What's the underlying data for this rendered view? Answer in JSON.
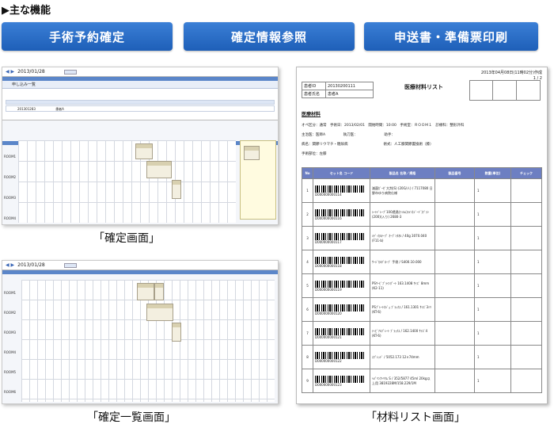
{
  "heading": "▶主な機能",
  "buttons": [
    "手術予約確定",
    "確定情報参照",
    "申送書・準備票印刷"
  ],
  "captions": [
    "「確定画面」",
    "「確定一覧画面」",
    "「材料リスト画面」"
  ],
  "shot1": {
    "date": "2013/01/28",
    "list_title": "申し込み一覧",
    "list_row_id": "201301283",
    "list_row_name": "患者A",
    "rooms": [
      "ROOM1",
      "ROOM2",
      "ROOM3",
      "ROOM4"
    ],
    "card_name": "患者A"
  },
  "shot2": {
    "date": "2013/01/28",
    "rooms": [
      "ROOM1",
      "ROOM2",
      "ROOM3",
      "ROOM4",
      "ROOM5",
      "ROOM6"
    ],
    "card_name": "患者A"
  },
  "doc": {
    "print_date": "2013年04月08日(11時02分)作成",
    "page": "1 / 2",
    "title": "医療材料リスト",
    "label_id": "患者ID",
    "patient_id": "20130200111",
    "label_name": "患者氏名",
    "patient_name": "患者A",
    "section": "医療材料",
    "line1": "オペ区分：通常　手術日：2013/02/01　開始時間：10:00　手術室：ＲＯＯＭ１　診療科：整形外科",
    "line2": "主治医：医師A　　　　　執刀医：　　　　　　　　助手：",
    "line3": "病名：関節リウマチ・糖尿病　　　　　　　　　　術式：人工膝関節置換術（膝）",
    "line4": "手術部位：左膝",
    "headers": [
      "No",
      "セット名 コード",
      "製品名 名称／規格",
      "製品番号",
      "数量(単位)",
      "チェック"
    ],
    "rows": [
      {
        "no": "1",
        "code": "D000000000114",
        "name": "滅菌ｶﾞｰｾﾞ大判(S) (20G/人) / 7117080 日野市ゆり病院仕様",
        "qty": "1"
      },
      {
        "no": "2",
        "code": "D000000000116",
        "name": "ｼｰﾄﾄﾞﾚｰﾌﾟ100透過(ﾌｨﾙﾑ)ﾗｲﾝ(ｼﾞｰﾄﾞ)ﾌﾞﾗﾝ(200)(入り) 2680-3",
        "qty": "1"
      },
      {
        "no": "3",
        "code": "D000000000117",
        "name": "ﾒﾃﾞｨｶﾙﾃｰﾌﾟ ｵｰﾌﾟﾝﾀｵﾙ / 40g 3070.040 (F11-b)",
        "qty": "1"
      },
      {
        "no": "4",
        "code": "D000000000118",
        "name": "ｻｰｼﾞｶﾙｸﾞﾛｰﾌﾞ 手袋 / S400.10.000",
        "qty": "1"
      },
      {
        "no": "5",
        "code": "D000000000119",
        "name": "PSｻｰﾋﾞﾌﾟﾗｲﾝﾎﾟｰﾄ 163.1408 ｻｲｽﾞ 8mm (K2-11)",
        "qty": "1"
      },
      {
        "no": "6",
        "code": "D000000000120",
        "name": "PSﾌﾟﾚｰﾄﾎｼﾞｮ ﾌﾞﾗｯｸｽ / 161.1301 ｻｲｽﾞ3ﾐﾘ (KT-6)",
        "qty": "1"
      },
      {
        "no": "7",
        "code": "D000000000121",
        "name": "ﾃｨﾋﾞｱﾙﾌﾟﾚｰﾄ ﾌﾞﾗｯｸｽ / 162.1400 ｻｲｽﾞ4 (KT-6)",
        "qty": "1"
      },
      {
        "no": "8",
        "code": "D000000000122",
        "name": "ｽﾌﾟﾚｯﾄﾞ / 5052.173 12×74mm",
        "qty": "1"
      },
      {
        "no": "9",
        "code": "D000000000123",
        "name": "ﾍﾊﾟﾘﾝﾅﾄﾘｳﾑ S / 352/5877 45ml 20kg以上用 3819228M/158.229/1M",
        "qty": "1"
      }
    ]
  }
}
